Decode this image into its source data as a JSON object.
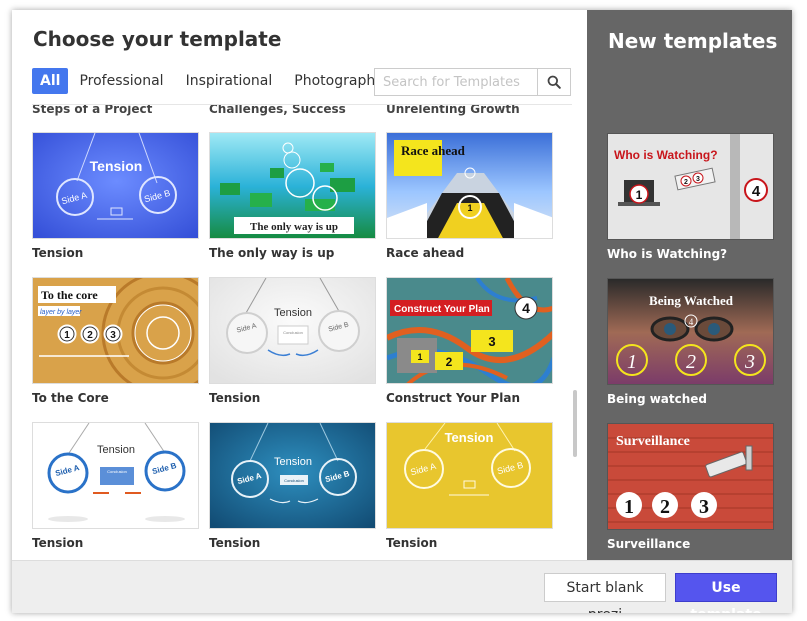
{
  "dialog": {
    "title": "Choose your template",
    "tabs": [
      {
        "label": "All",
        "active": true
      },
      {
        "label": "Professional",
        "active": false
      },
      {
        "label": "Inspirational",
        "active": false
      },
      {
        "label": "Photographic",
        "active": false
      }
    ],
    "search": {
      "placeholder": "Search for Templates",
      "icon": "search-icon"
    },
    "cut_row_labels": [
      "Steps of a Project",
      "Challenges, Success",
      "Unrelenting Growth"
    ],
    "templates": [
      {
        "label": "Tension",
        "thumb_text": [
          "Tension",
          "Side A",
          "Side B"
        ]
      },
      {
        "label": "The only way is up",
        "thumb_text": [
          "The only way is up"
        ]
      },
      {
        "label": "Race ahead",
        "thumb_text": [
          "Race ahead",
          "1"
        ]
      },
      {
        "label": "To the Core",
        "thumb_text": [
          "To the core",
          "layer by layer",
          "1",
          "2",
          "3"
        ]
      },
      {
        "label": "Tension",
        "thumb_text": [
          "Tension",
          "Side A",
          "Side B",
          "Conclusion"
        ]
      },
      {
        "label": "Construct Your Plan",
        "thumb_text": [
          "Construct Your Plan",
          "1",
          "2",
          "3",
          "4"
        ]
      },
      {
        "label": "Tension",
        "thumb_text": [
          "Tension",
          "Side A",
          "Side B",
          "Conclusion"
        ]
      },
      {
        "label": "Tension",
        "thumb_text": [
          "Tension",
          "Side A",
          "Side B",
          "Conclusion"
        ]
      },
      {
        "label": "Tension",
        "thumb_text": [
          "Tension",
          "Side A",
          "Side B"
        ]
      }
    ]
  },
  "sidebar": {
    "title": "New templates",
    "templates": [
      {
        "label": "Who is Watching?",
        "thumb_text": [
          "Who is Watching?",
          "1",
          "2",
          "3",
          "4"
        ]
      },
      {
        "label": "Being watched",
        "thumb_text": [
          "Being Watched",
          "1",
          "2",
          "3",
          "4"
        ]
      },
      {
        "label": "Surveillance",
        "thumb_text": [
          "Surveillance",
          "1",
          "2",
          "3"
        ]
      }
    ]
  },
  "footer": {
    "blank_label": "Start blank prezi",
    "use_label": "Use template"
  },
  "colors": {
    "accent": "#4477ee",
    "use_button": "#5555ee",
    "sidebar_bg": "#666666"
  }
}
